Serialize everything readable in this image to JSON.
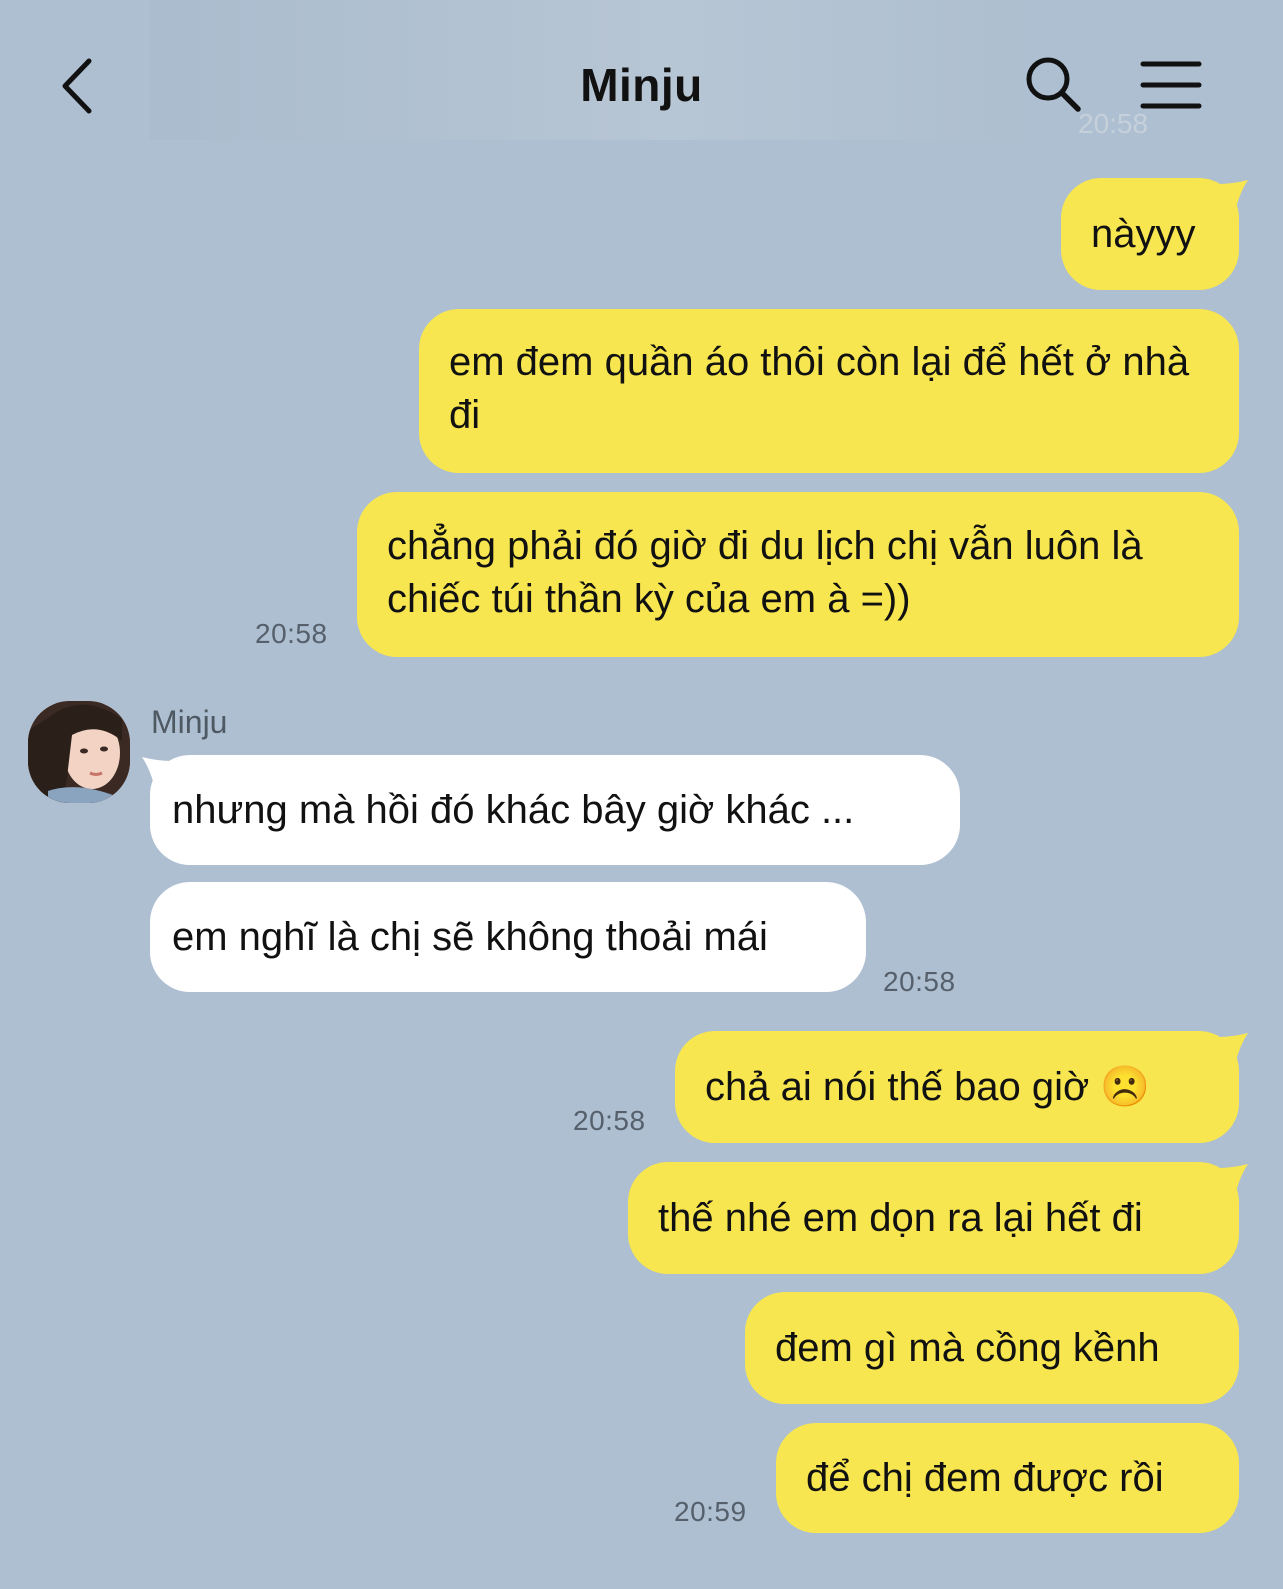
{
  "header": {
    "title": "Minju",
    "back_icon": "chevron-left-icon",
    "search_icon": "search-icon",
    "menu_icon": "menu-icon",
    "ghost_time": "20:58"
  },
  "colors": {
    "background": "#adbfd1",
    "my_bubble": "#f7e64f",
    "their_bubble": "#ffffff",
    "time_text": "#56606c"
  },
  "messages": [
    {
      "from": "me",
      "text": "nàyyy"
    },
    {
      "from": "me",
      "text": "em đem quần áo thôi còn lại để hết ở nhà đi"
    },
    {
      "from": "me",
      "text": "chẳng phải đó giờ đi du lịch chị vẫn luôn là chiếc túi thần kỳ của em à =))",
      "time": "20:58"
    },
    {
      "from": "them",
      "sender": "Minju",
      "text": "nhưng mà hồi đó khác bây giờ khác ..."
    },
    {
      "from": "them",
      "text": "em nghĩ là chị sẽ không thoải mái",
      "time": "20:58"
    },
    {
      "from": "me",
      "text": "chả ai nói thế bao giờ ☹️",
      "time": "20:58"
    },
    {
      "from": "me",
      "text": "thế nhé em dọn ra lại hết đi"
    },
    {
      "from": "me",
      "text": "đem gì mà cồng kềnh"
    },
    {
      "from": "me",
      "text": "để chị đem được rồi",
      "time": "20:59"
    }
  ]
}
